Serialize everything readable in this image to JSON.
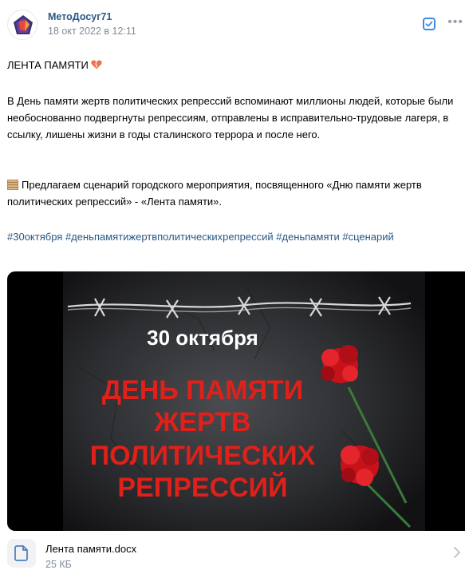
{
  "post": {
    "author": "МетоДосуг71",
    "date": "18 окт 2022 в 12:11",
    "title_line": "ЛЕНТА ПАМЯТИ",
    "paragraph1": "В День памяти жертв политических репрессий вспоминают миллионы людей, которые были необоснованно подвергнуты репрессиям, отправлены в исправительно-трудовые лагеря, в ссылку, лишены жизни в годы сталинского террора и после него.",
    "paragraph2": "Предлагаем сценарий городского мероприятия, посвященного «Дню памяти жертв политических репрессий» - «Лента памяти».",
    "hashtags": [
      "#30октября",
      "#деньпамятижертвполитическихрепрессий",
      "#деньпамяти",
      "#сценарий"
    ]
  },
  "image": {
    "date_text": "30 октября",
    "title_lines": [
      "ДЕНЬ ПАМЯТИ",
      "ЖЕРТВ",
      "ПОЛИТИЧЕСКИХ",
      "РЕПРЕССИЙ"
    ]
  },
  "attachment": {
    "name": "Лента памяти.docx",
    "size": "25 КБ"
  },
  "icons": {
    "avatar": "pentagon-logo-icon",
    "check": "checkbox-icon",
    "more": "more-horizontal-icon",
    "heart": "broken-heart-icon",
    "scroll": "scroll-icon",
    "document": "document-icon",
    "chevron": "chevron-right-icon"
  },
  "colors": {
    "link": "#2a5885",
    "secondary_text": "#818c99",
    "accent": "#3f8ae0",
    "poster_red": "#e0201a"
  }
}
